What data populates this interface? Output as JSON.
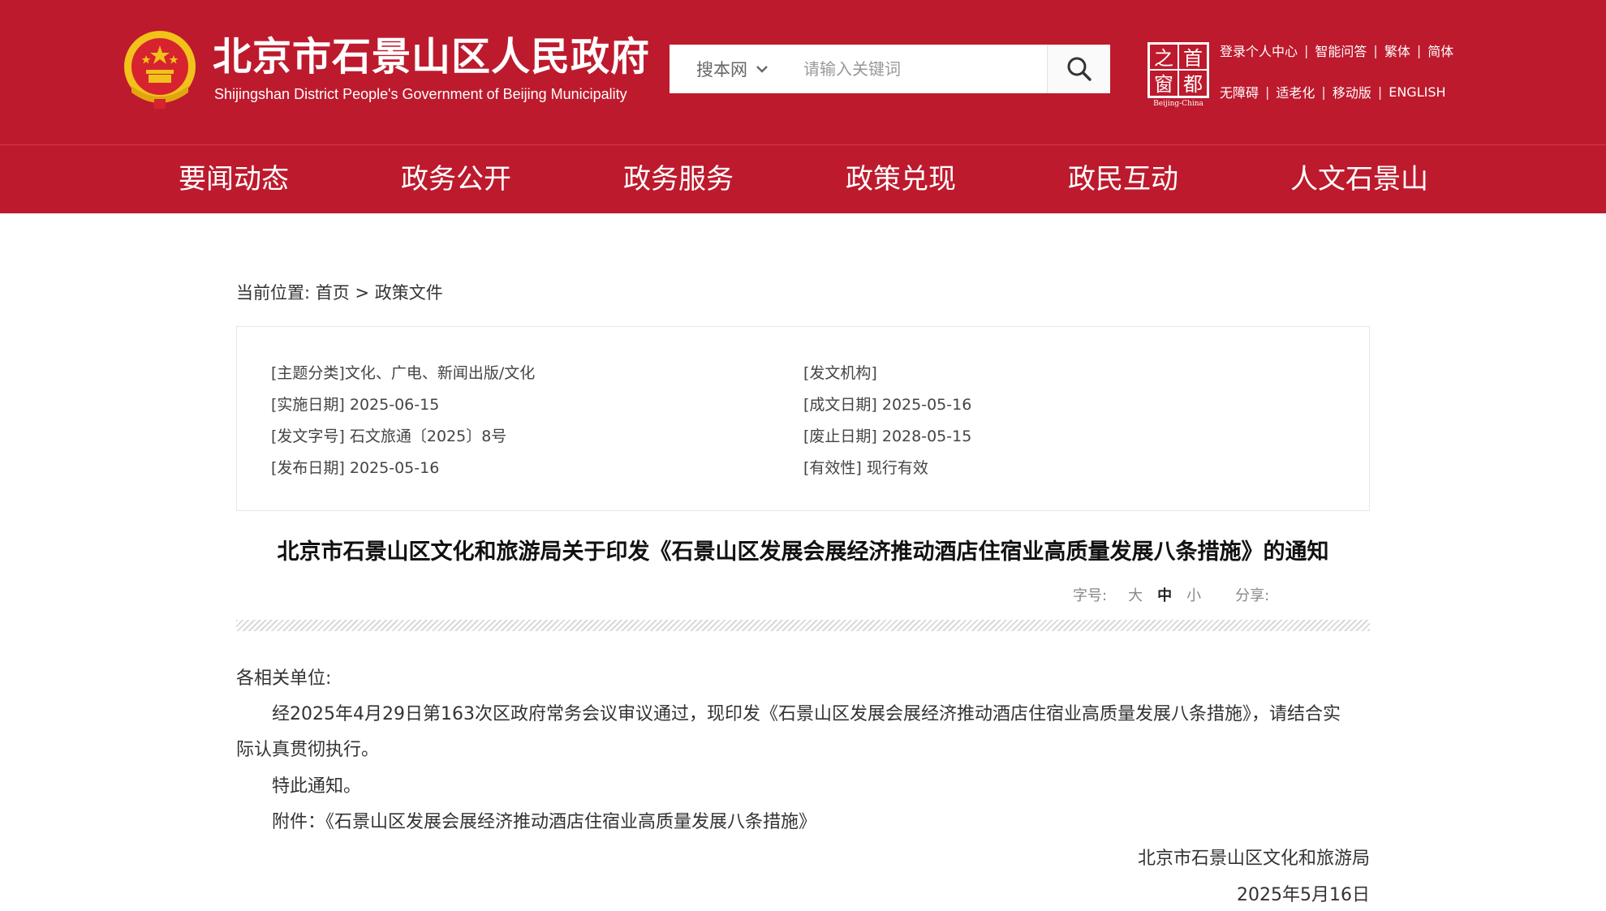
{
  "header": {
    "title": "北京市石景山区人民政府",
    "subtitle": "Shijingshan District People's Government of Beijing Municipality",
    "search": {
      "scope_label": "搜本网",
      "placeholder": "请输入关键词",
      "value": ""
    },
    "capital_logo": {
      "chars": [
        "首",
        "都",
        "之",
        "窗"
      ],
      "caption": "Beijing-China"
    },
    "links_row1": [
      "登录个人中心",
      "智能问答",
      "繁体",
      "简体"
    ],
    "links_row2": [
      "无障碍",
      "适老化",
      "移动版",
      "ENGLISH"
    ]
  },
  "nav": [
    "要闻动态",
    "政务公开",
    "政务服务",
    "政策兑现",
    "政民互动",
    "人文石景山"
  ],
  "breadcrumb": {
    "prefix": "当前位置:",
    "home": "首页",
    "sep": ">",
    "current": "政策文件"
  },
  "meta": {
    "topic": "[主题分类]文化、广电、新闻出版/文化",
    "issuer": "[发文机构]",
    "effective_date": "[实施日期] 2025-06-15",
    "written_date": "[成文日期] 2025-05-16",
    "doc_number": "[发文字号] 石文旅通〔2025〕8号",
    "expiry_date": "[废止日期] 2028-05-15",
    "publish_date": "[发布日期] 2025-05-16",
    "validity": "[有效性] 现行有效"
  },
  "doc": {
    "title": "北京市石景山区文化和旅游局关于印发《石景山区发展会展经济推动酒店住宿业高质量发展八条措施》的通知",
    "tools": {
      "font_label": "字号:",
      "sizes": [
        "大",
        "中",
        "小"
      ],
      "share_label": "分享:"
    },
    "salutation": "各相关单位:",
    "para1_line1": "经2025年4月29日第163次区政府常务会议审议通过，现印发《石景山区发展会展经济推动酒店住宿业高质量发展八条措施》，请结合实",
    "para1_line2": "际认真贯彻执行。",
    "para2": "特此通知。",
    "attachment": "附件：《石景山区发展会展经济推动酒店住宿业高质量发展八条措施》",
    "signature": "北京市石景山区文化和旅游局",
    "date": "2025年5月16日"
  },
  "colors": {
    "brand_red": "#bd1a2d",
    "emblem_gold": "#f2c21b"
  }
}
